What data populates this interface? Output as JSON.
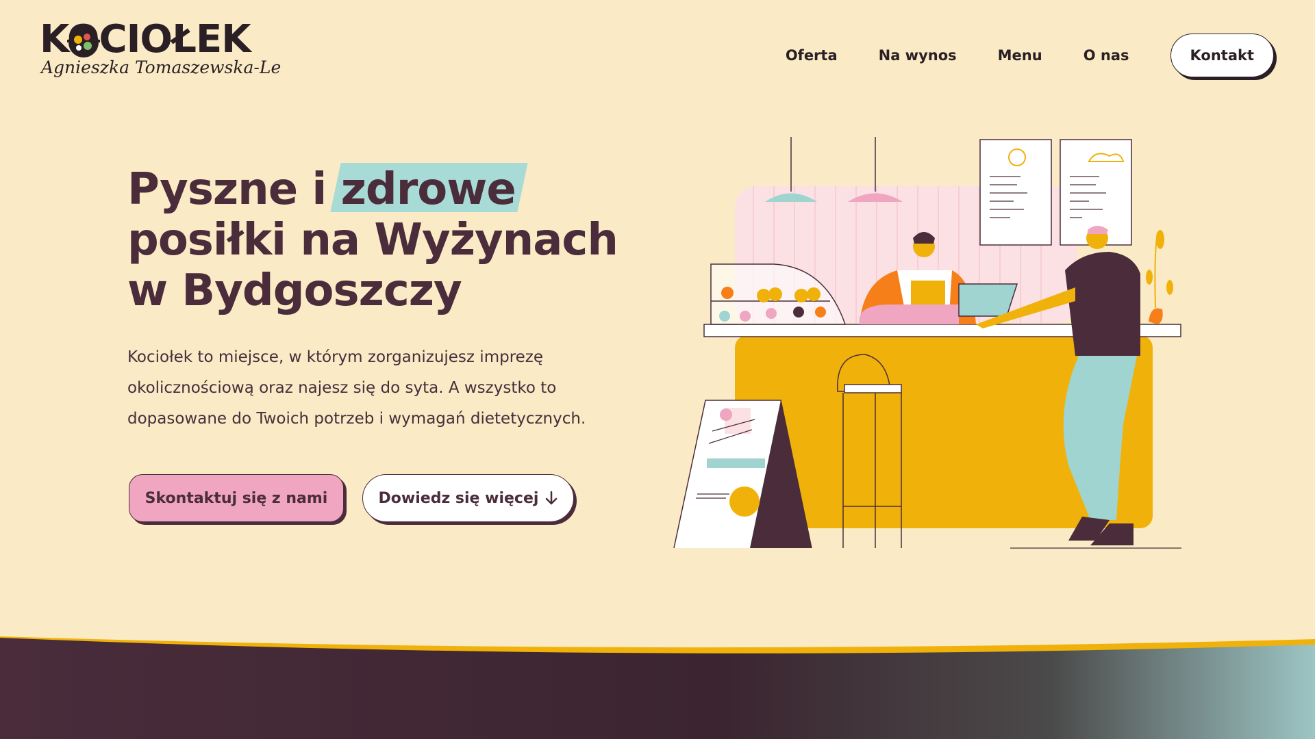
{
  "brand": {
    "name": "KOCIOŁEK",
    "signature": "Agnieszka Tomaszewska-Le"
  },
  "nav": {
    "items": [
      "Oferta",
      "Na wynos",
      "Menu",
      "O nas"
    ],
    "cta": "Kontakt"
  },
  "hero": {
    "title_part1": "Pyszne i ",
    "title_highlight": "zdrowe",
    "title_line2": "posiłki na Wyżynach",
    "title_line3": "w Bydgoszczy",
    "description": "Kociołek to miejsce, w którym zorganizujesz imprezę okolicznościową oraz najesz się do syta. A wszystko to dopasowane do Twoich potrzeb i wymagań dietetycznych.",
    "primary_button": "Skontaktuj się z nami",
    "secondary_button": "Dowiedz się więcej",
    "secondary_button_icon": "arrow-down-icon"
  },
  "colors": {
    "background": "#faebc6",
    "text": "#4a2c3b",
    "highlight": "#a8dad6",
    "primary_button": "#f0a5c0",
    "accent_yellow": "#f0b20a",
    "accent_orange": "#f77f1a",
    "plum": "#4a2c3b"
  }
}
